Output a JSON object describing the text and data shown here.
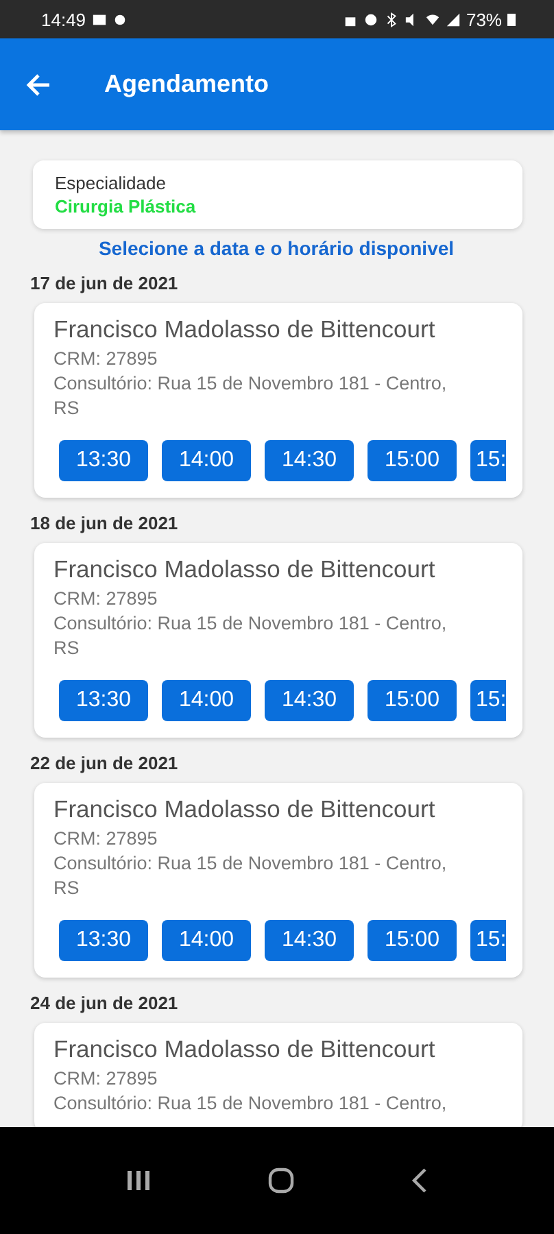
{
  "status_bar": {
    "time": "14:49",
    "battery": "73%"
  },
  "app_bar": {
    "title": "Agendamento"
  },
  "specialty": {
    "label": "Especialidade",
    "value": "Cirurgia Plástica"
  },
  "instruction": "Selecione a data e o horário disponivel",
  "days": [
    {
      "date": "17 de jun de 2021",
      "doctor": "Francisco Madolasso de Bittencourt",
      "crm": "CRM: 27895",
      "address": "Consultório: Rua 15 de Novembro 181 - Centro, RS",
      "times": [
        {
          "label": "13:30",
          "kind": "full"
        },
        {
          "label": "14:00",
          "kind": "full"
        },
        {
          "label": "14:30",
          "kind": "full"
        },
        {
          "label": "15:00",
          "kind": "full"
        },
        {
          "label": "15:",
          "kind": "partial"
        }
      ]
    },
    {
      "date": "18 de jun de 2021",
      "doctor": "Francisco Madolasso de Bittencourt",
      "crm": "CRM: 27895",
      "address": "Consultório: Rua 15 de Novembro 181 - Centro, RS",
      "times": [
        {
          "label": "13:30",
          "kind": "full"
        },
        {
          "label": "14:00",
          "kind": "full"
        },
        {
          "label": "14:30",
          "kind": "full"
        },
        {
          "label": "15:00",
          "kind": "full"
        },
        {
          "label": "15:",
          "kind": "partial"
        }
      ]
    },
    {
      "date": "22 de jun de 2021",
      "doctor": "Francisco Madolasso de Bittencourt",
      "crm": "CRM: 27895",
      "address": "Consultório: Rua 15 de Novembro 181 - Centro, RS",
      "times": [
        {
          "label": "13:30",
          "kind": "full"
        },
        {
          "label": "14:00",
          "kind": "full"
        },
        {
          "label": "14:30",
          "kind": "full"
        },
        {
          "label": "15:00",
          "kind": "full"
        },
        {
          "label": "15:",
          "kind": "partial"
        }
      ]
    },
    {
      "date": "24 de jun de 2021",
      "doctor": "Francisco Madolasso de Bittencourt",
      "crm": "CRM: 27895",
      "address": "Consultório: Rua 15 de Novembro 181 - Centro,"
    }
  ]
}
